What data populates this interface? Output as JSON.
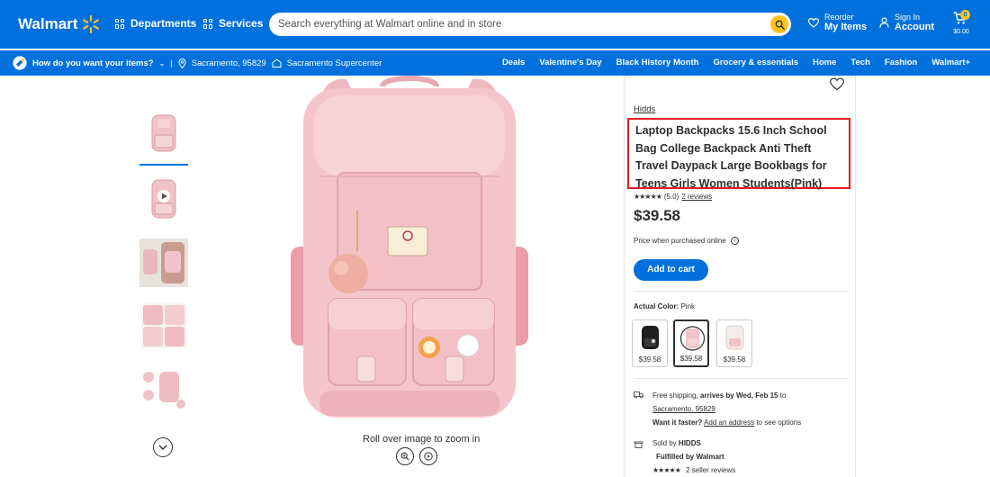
{
  "header": {
    "logo_text": "Walmart",
    "departments": "Departments",
    "services": "Services",
    "search_placeholder": "Search everything at Walmart online and in store",
    "reorder_small": "Reorder",
    "reorder_big": "My Items",
    "signin_small": "Sign In",
    "signin_big": "Account",
    "cart_count": "0",
    "cart_total": "$0.00",
    "brand_blue": "#0071dc",
    "spark_yellow": "#ffc220"
  },
  "subbar": {
    "question": "How do you want your items?",
    "location": "Sacramento, 95829",
    "store": "Sacramento Supercenter",
    "nav": [
      "Deals",
      "Valentine's Day",
      "Black History Month",
      "Grocery & essentials",
      "Home",
      "Tech",
      "Fashion",
      "Walmart+"
    ]
  },
  "gallery": {
    "zoom_hint": "Roll over image to zoom in",
    "selected_thumb": 0
  },
  "product": {
    "brand": "Hidds",
    "title": "Laptop Backpacks 15.6 Inch School Bag College Backpack Anti Theft Travel Daypack Large Bookbags for Teens Girls Women Students(Pink)",
    "stars": "★★★★★",
    "rating": "(5.0)",
    "reviews": "2 reviews",
    "price": "$39.58",
    "price_note": "Price when purchased online",
    "add_to_cart": "Add to cart",
    "color_label": "Actual Color:",
    "color_value": "Pink",
    "variants": [
      {
        "name": "black",
        "price": "$39.58"
      },
      {
        "name": "pink",
        "price": "$39.58"
      },
      {
        "name": "white",
        "price": "$39.58"
      }
    ],
    "shipping": {
      "free": "Free shipping,",
      "arrives": "arrives by Wed, Feb 15",
      "to": "to",
      "location": "Sacramento, 95829",
      "faster": "Want it faster?",
      "address_link": "Add an address",
      "options": "to see options"
    },
    "seller": {
      "sold_by": "Sold by",
      "seller_name": "HIDDS",
      "fulfilled": "Fulfilled by Walmart",
      "seller_reviews": "2 seller reviews",
      "seller_stars": "★★★★★"
    },
    "highlight_color": "#e31b23",
    "bag_color": "#f2c4c8"
  }
}
